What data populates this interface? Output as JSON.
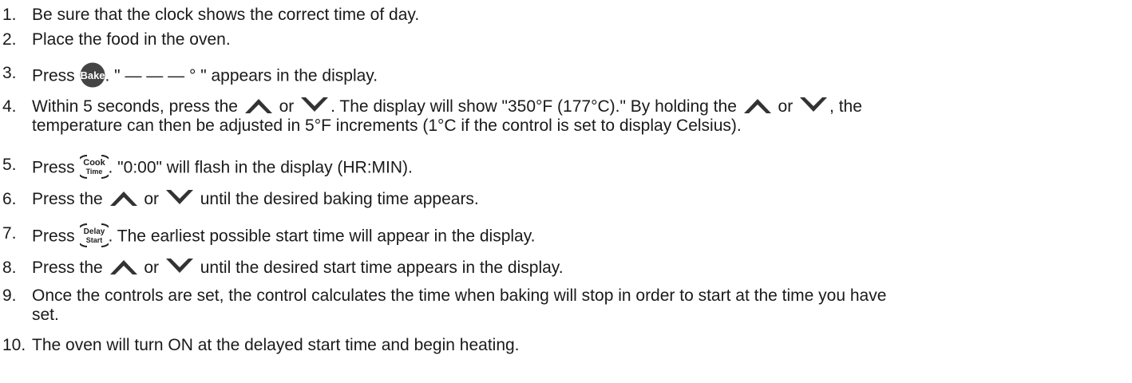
{
  "steps": [
    {
      "num": "1.",
      "text": "Be sure that the clock shows the correct time of day."
    },
    {
      "num": "2.",
      "text": "Place the food in the oven."
    },
    {
      "num": "3.",
      "a": "Press ",
      "key": "Bake",
      "b": ". \" — — — ° \" appears in the display."
    },
    {
      "num": "4.",
      "a": "Within 5 seconds, press the ",
      "or1": " or ",
      "b": ". The display will show \"350°F (177°C).\" By holding the ",
      "or2": " or ",
      "c": ", the",
      "line2": "temperature can then be adjusted in 5°F increments (1°C if the control is set to display Celsius)."
    },
    {
      "num": "5.",
      "a": "Press ",
      "key_top": "Cook",
      "key_bottom": "Time",
      "b": ". \"0:00\" will flash in the display (HR:MIN)."
    },
    {
      "num": "6.",
      "a": "Press the ",
      "or1": " or ",
      "b": " until the desired baking time appears."
    },
    {
      "num": "7.",
      "a": "Press ",
      "key_top": "Delay",
      "key_bottom": "Start",
      "b": ". The earliest possible start time will appear in the display."
    },
    {
      "num": "8.",
      "a": "Press the ",
      "or1": " or ",
      "b": " until the desired start time appears in the display."
    },
    {
      "num": "9.",
      "text": "Once the controls are set, the control calculates the time when baking will stop in order to start at the time you have",
      "line2": "set."
    },
    {
      "num": "10.",
      "text": "The oven will turn ON at the delayed start time and begin heating."
    }
  ],
  "icons": {
    "up": "up-arrow-key-icon",
    "down": "down-arrow-key-icon",
    "bake": "bake-key-icon",
    "cook_time": "cook-time-key-icon",
    "delay_start": "delay-start-key-icon"
  },
  "colors": {
    "text": "#1a1a1a",
    "bake_key_fill": "#444444"
  }
}
